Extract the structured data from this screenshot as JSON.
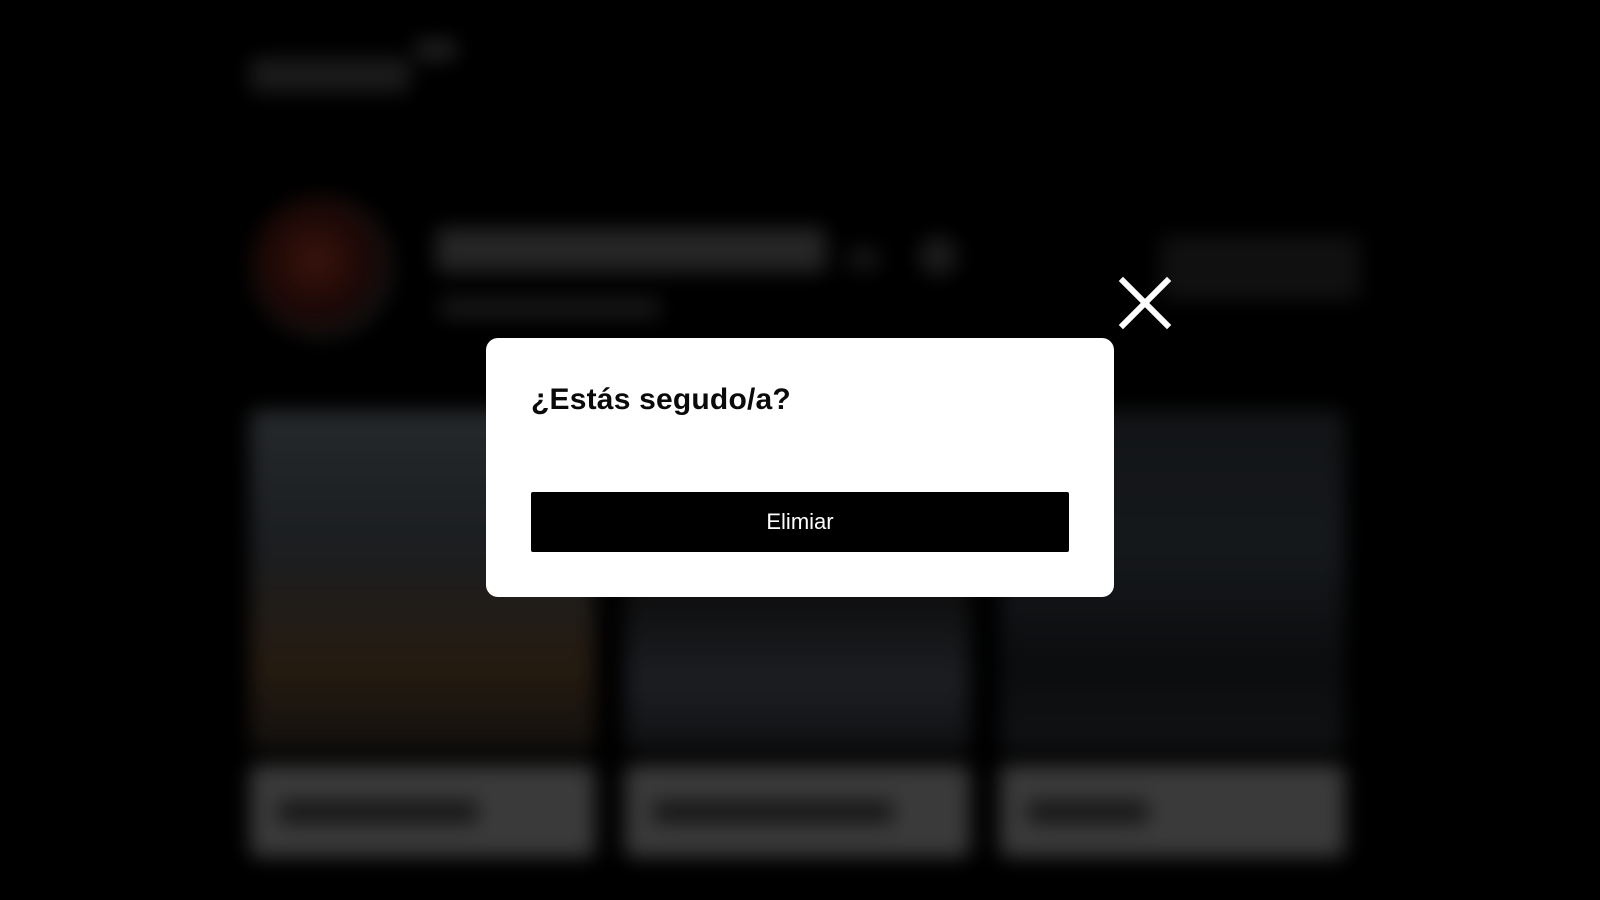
{
  "modal": {
    "title": "¿Estás segudo/a?",
    "confirm_label": "Elimiar"
  },
  "close": {
    "icon": "close-icon",
    "color": "#ffffff"
  },
  "colors": {
    "modal_background": "#ffffff",
    "button_background": "#000000",
    "button_text": "#ffffff",
    "page_background": "#000000"
  }
}
